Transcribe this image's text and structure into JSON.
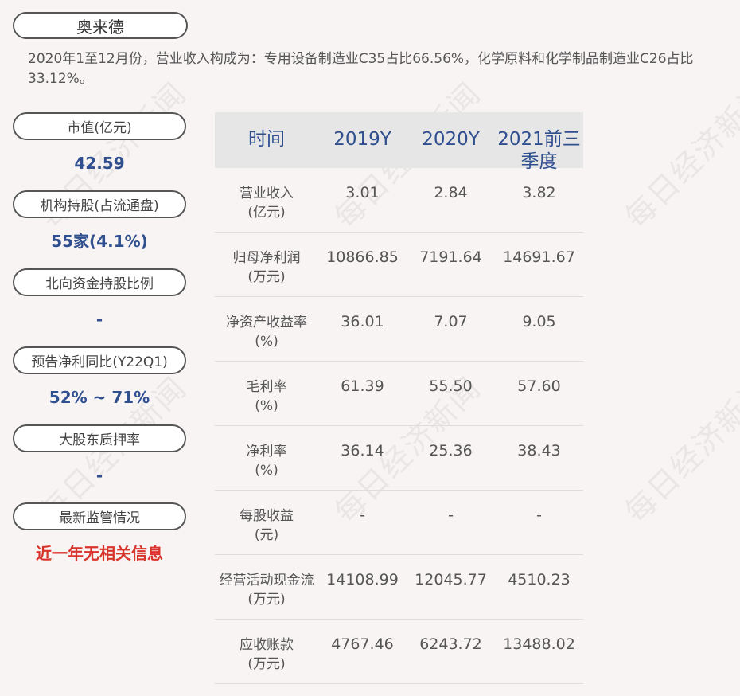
{
  "company": "奥来德",
  "summary": "2020年1至12月份，营业收入构成为：专用设备制造业C35占比66.56%，化学原料和化学制品制造业C26占比33.12%。",
  "watermark": "每日经济新闻",
  "metrics": [
    {
      "label": "市值(亿元)",
      "value": "42.59",
      "color": "#2f4f8f"
    },
    {
      "label": "机构持股(占流通盘)",
      "value": "55家(4.1%)",
      "color": "#2f4f8f"
    },
    {
      "label": "北向资金持股比例",
      "value": "-",
      "color": "#2f4f8f"
    },
    {
      "label": "预告净利同比(Y22Q1)",
      "value": "52% ~ 71%",
      "color": "#2f4f8f"
    },
    {
      "label": "大股东质押率",
      "value": "-",
      "color": "#2f4f8f"
    },
    {
      "label": "最新监管情况",
      "value": "近一年无相关信息",
      "color": "#d9342b"
    }
  ],
  "table": {
    "headers": [
      "时间",
      "2019Y",
      "2020Y",
      "2021前三季度"
    ],
    "rows": [
      {
        "label": "营业收入",
        "unit": "(亿元)",
        "values": [
          "3.01",
          "2.84",
          "3.82"
        ]
      },
      {
        "label": "归母净利润",
        "unit": "(万元)",
        "values": [
          "10866.85",
          "7191.64",
          "14691.67"
        ]
      },
      {
        "label": "净资产收益率",
        "unit": "(%)",
        "values": [
          "36.01",
          "7.07",
          "9.05"
        ]
      },
      {
        "label": "毛利率",
        "unit": "(%)",
        "values": [
          "61.39",
          "55.50",
          "57.60"
        ]
      },
      {
        "label": "净利率",
        "unit": "(%)",
        "values": [
          "36.14",
          "25.36",
          "38.43"
        ]
      },
      {
        "label": "每股收益",
        "unit": "(元)",
        "values": [
          "-",
          "-",
          "-"
        ]
      },
      {
        "label": "经营活动现金流",
        "unit": "(万元)",
        "values": [
          "14108.99",
          "12045.77",
          "4510.23"
        ]
      },
      {
        "label": "应收账款",
        "unit": "(万元)",
        "values": [
          "4767.46",
          "6243.72",
          "13488.02"
        ]
      }
    ]
  }
}
